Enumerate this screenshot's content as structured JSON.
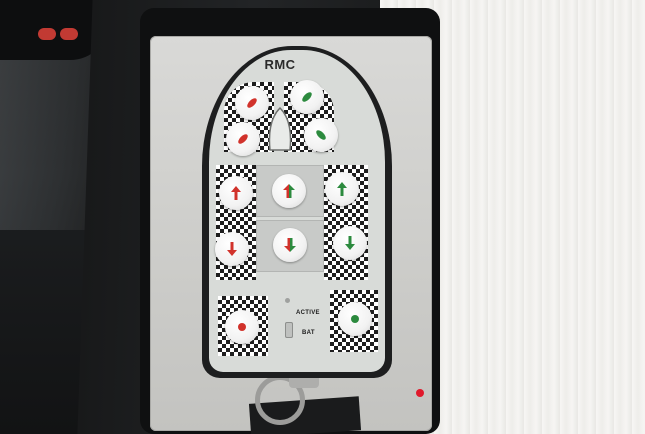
{
  "device": {
    "brand": "RMC",
    "status_active_label": "ACTIVE",
    "status_bat_label": "BAT"
  },
  "buttons": [
    {
      "name": "bow-left-button",
      "symbol": "leaf-diag",
      "color": "#d1322b"
    },
    {
      "name": "bow-right-button",
      "symbol": "leaf-diag",
      "color": "#2c8a3e"
    },
    {
      "name": "mid-left-button",
      "symbol": "leaf-diag",
      "color": "#d1322b"
    },
    {
      "name": "mid-right-button",
      "symbol": "leaf-diag",
      "color": "#2c8a3e"
    },
    {
      "name": "turn-left-forward-button",
      "symbol": "arrow-up",
      "color": "#d1322b"
    },
    {
      "name": "forward-button",
      "symbol": "arrow-up-dual",
      "color": "#d1322b"
    },
    {
      "name": "turn-right-forward-button",
      "symbol": "arrow-up",
      "color": "#2c8a3e"
    },
    {
      "name": "turn-left-back-button",
      "symbol": "arrow-down",
      "color": "#d1322b"
    },
    {
      "name": "reverse-button",
      "symbol": "arrow-down-dual",
      "color": "#d1322b"
    },
    {
      "name": "turn-right-back-button",
      "symbol": "arrow-down",
      "color": "#2c8a3e"
    },
    {
      "name": "stern-left-button",
      "symbol": "dot",
      "color": "#d1322b"
    },
    {
      "name": "stern-right-button",
      "symbol": "dot",
      "color": "#2c8a3e"
    }
  ],
  "colors": {
    "port": "#d1322b",
    "starboard": "#2c8a3e",
    "indicator": "#e0192b"
  }
}
